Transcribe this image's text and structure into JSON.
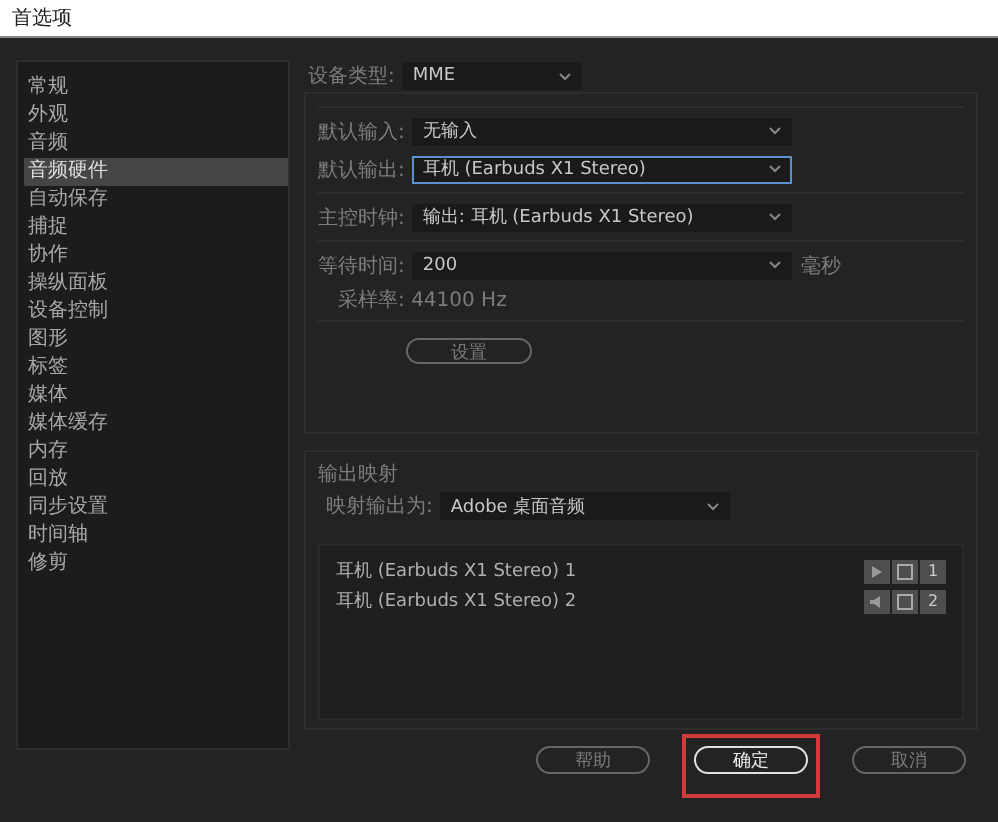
{
  "window": {
    "title": "首选项"
  },
  "sidebar": {
    "items": [
      {
        "label": "常规",
        "selected": false
      },
      {
        "label": "外观",
        "selected": false
      },
      {
        "label": "音频",
        "selected": false
      },
      {
        "label": "音频硬件",
        "selected": true
      },
      {
        "label": "自动保存",
        "selected": false
      },
      {
        "label": "捕捉",
        "selected": false
      },
      {
        "label": "协作",
        "selected": false
      },
      {
        "label": "操纵面板",
        "selected": false
      },
      {
        "label": "设备控制",
        "selected": false
      },
      {
        "label": "图形",
        "selected": false
      },
      {
        "label": "标签",
        "selected": false
      },
      {
        "label": "媒体",
        "selected": false
      },
      {
        "label": "媒体缓存",
        "selected": false
      },
      {
        "label": "内存",
        "selected": false
      },
      {
        "label": "回放",
        "selected": false
      },
      {
        "label": "同步设置",
        "selected": false
      },
      {
        "label": "时间轴",
        "selected": false
      },
      {
        "label": "修剪",
        "selected": false
      }
    ]
  },
  "device_type": {
    "label": "设备类型:",
    "value": "MME"
  },
  "device_fields": [
    {
      "label": "默认输入:",
      "value": "无输入",
      "focused": false
    },
    {
      "label": "默认输出:",
      "value": "耳机 (Earbuds X1 Stereo)",
      "focused": true
    },
    {
      "label": "主控时钟:",
      "value": "输出: 耳机 (Earbuds X1 Stereo)",
      "focused": false
    },
    {
      "label": "等待时间:",
      "value": "200",
      "unit": "毫秒",
      "focused": false
    }
  ],
  "sample_rate": {
    "label": "采样率:",
    "value": "44100 Hz"
  },
  "settings_button": {
    "label": "设置"
  },
  "output_mapping": {
    "title": "输出映射",
    "map_label": "映射输出为:",
    "map_value": "Adobe 桌面音频",
    "channels": [
      {
        "label": "耳机 (Earbuds X1 Stereo) 1",
        "number": "1"
      },
      {
        "label": "耳机 (Earbuds X1 Stereo) 2",
        "number": "2"
      }
    ]
  },
  "buttons": [
    {
      "label": "帮助",
      "primary": false,
      "highlighted": false
    },
    {
      "label": "确定",
      "primary": true,
      "highlighted": true
    },
    {
      "label": "取消",
      "primary": false,
      "highlighted": false
    }
  ]
}
